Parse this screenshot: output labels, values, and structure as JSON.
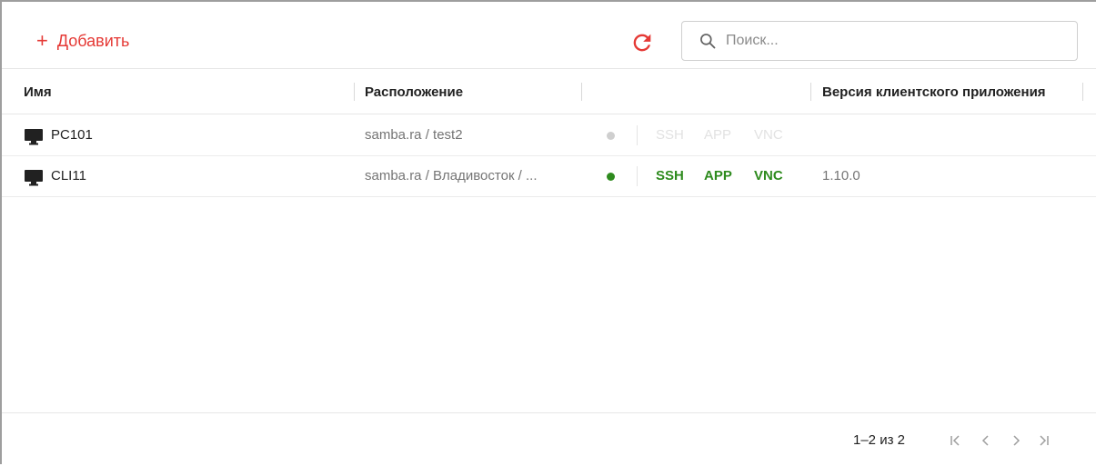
{
  "toolbar": {
    "add_label": "Добавить",
    "search_placeholder": "Поиск..."
  },
  "colors": {
    "accent": "#e53935",
    "online": "#2e8b1e",
    "offline": "#cfcfcf"
  },
  "table": {
    "columns": [
      "Имя",
      "Расположение",
      "Версия клиентского приложения"
    ],
    "rows": [
      {
        "name": "PC101",
        "location": "samba.ra / test2",
        "status": "offline",
        "protocols": [
          "SSH",
          "APP",
          "VNC"
        ],
        "version": ""
      },
      {
        "name": "CLI11",
        "location": "samba.ra / Владивосток / ...",
        "status": "online",
        "protocols": [
          "SSH",
          "APP",
          "VNC"
        ],
        "version": "1.10.0"
      }
    ]
  },
  "pagination": {
    "range": "1–2 из 2"
  }
}
